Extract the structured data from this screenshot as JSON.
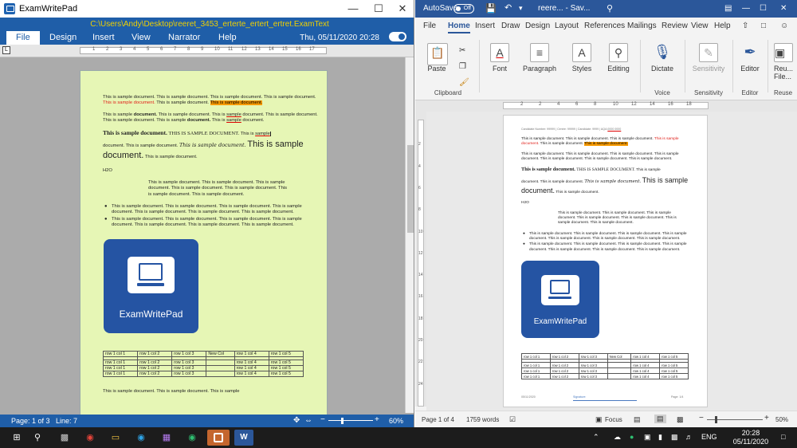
{
  "ewp": {
    "window_title": "ExamWritePad",
    "file_path": "C:\\Users\\Andy\\Desktop\\reeret_3453_erterte_ertert_ertret.ExamText",
    "tabs": [
      "File",
      "Design",
      "Insert",
      "View",
      "Narrator",
      "Help"
    ],
    "datetime": "Thu, 05/11/2020 20:28",
    "ruler_numbers": [
      "1",
      "2",
      "3",
      "4",
      "5",
      "6",
      "7",
      "8",
      "9",
      "10",
      "11",
      "12",
      "13",
      "14",
      "15",
      "16",
      "17"
    ],
    "status": {
      "page": "Page: 1 of 3",
      "line": "Line: 7",
      "zoom": "60%"
    },
    "doc": {
      "p1a": "This is sample document. This is sample document. This is sample document. This is sample",
      "p1b": "document.",
      "p1red": "This is sample document.",
      "p1c": "This is sample document.",
      "p1or": "This is sample document.",
      "p2a": "This is sample",
      "p2b_bold": "document.",
      "p2c": "This is sample document. This is",
      "p2d_u": "sample",
      "p2e": "document. This is sample",
      "p2f": "document. This is sample document. This is sample",
      "p2g_bold": "document.",
      "p2h": "This is",
      "p2i_u": "sample",
      "p2j": "document.",
      "p3_serif_bold": "This is sample document.",
      "p3_caps": "THIS IS SAMPLE DOCUMENT.",
      "p3_tail": "This is",
      "p3_u": "sample",
      "p4a": "document. This is sample document.",
      "p4_ital": "This is sample document.",
      "p4_big": "This is sample",
      "p5_big": "document.",
      "p5_small": "This is sample document.",
      "h2o": "H2O",
      "indent": "This is sample document. This is sample document. This is sample document. This is sample document. This is sample document. This is sample document. This is sample document.",
      "bullets": [
        "This is sample document. This is sample document. This is sample document. This is sample document. This is sample document. This is sample document. This is sample document.",
        "This is sample document. This is sample document. This is sample document. This is sample document. This is sample document. This is sample document. This is sample document."
      ],
      "logo_text": "ExamWritePad",
      "table": [
        [
          "row 1 col 1",
          "row 1 col 2",
          "row 1 col 3",
          "New Col",
          "row 1 col 4",
          "row 1 col 5"
        ],
        [
          "",
          "",
          "",
          "",
          "",
          ""
        ],
        [
          "row 1 col 1",
          "row 1 col 2",
          "row 1 col 3",
          "",
          "row 1 col 4",
          "row 1 col 5"
        ],
        [
          "row 1 col 1",
          "row 1 col 2",
          "row 1 col 3",
          "",
          "row 1 col 4",
          "row 1 col 5"
        ],
        [
          "row 1 col 1",
          "row 1 col 2",
          "row 1 col 3",
          "",
          "row 1 col 4",
          "row 1 col 5"
        ]
      ],
      "last_line": "This is sample document. This is sample document. This is sample"
    }
  },
  "word": {
    "autosave": "AutoSave",
    "autosave_state": "Off",
    "doc_title": "reere... - Sav...",
    "tabs": [
      "File",
      "Home",
      "Insert",
      "Draw",
      "Design",
      "Layout",
      "References",
      "Mailings",
      "Review",
      "View",
      "Help"
    ],
    "ribbon": {
      "paste": "Paste",
      "clipboard": "Clipboard",
      "font": "Font",
      "paragraph": "Paragraph",
      "styles": "Styles",
      "editing": "Editing",
      "dictate": "Dictate",
      "voice": "Voice",
      "sensitivity": "Sensitivity",
      "sensitivity_group": "Sensitivity",
      "editor": "Editor",
      "editor_group": "Editor",
      "reuse_files": "Reu... File...",
      "reuse_group": "Reuse"
    },
    "hruler_numbers": [
      "2",
      "2",
      "4",
      "6",
      "8",
      "10",
      "12",
      "14",
      "16",
      "18"
    ],
    "vruler_numbers": [
      "2",
      "4",
      "6",
      "8",
      "10",
      "12",
      "14",
      "16",
      "18",
      "20",
      "22",
      "24"
    ],
    "doc": {
      "header": "Candidate Number: 99999 | Centre: 99999 | Candidate: 9999 | AQA",
      "header_tail": "0000 0000",
      "p1a": "This is sample document. This is sample document. This is sample document.",
      "p1red": "This is sample document.",
      "p1b": "This is sample document.",
      "p1or": "This is sample document.",
      "p2": "This is sample document. This is sample document. This is sample document. This is sample document. This is sample document. This is sample document. This is sample document.",
      "p3_serif_bold": "This is sample document.",
      "p3_caps": "THIS IS SAMPLE DOCUMENT.",
      "p3_tail": "This is sample",
      "p4a": "document. This is sample document.",
      "p4_ital": "This is sample document.",
      "p4_big": "This is sample",
      "p5_big": "document.",
      "p5_small": "This is sample document.",
      "h2o": "H2O",
      "indent": "This is sample document. This is sample document. This is sample document. This is sample document. This is sample document. This is sample document. This is sample document.",
      "bullets": [
        "This is sample document. This is sample document. This is sample document. This is sample document. This is sample document. This is sample document. This is sample document.",
        "This is sample document. This is sample document. This is sample document. This is sample document. This is sample document. This is sample document. This is sample document."
      ],
      "logo_text": "ExamWritePad",
      "table": [
        [
          "row 1 col 1",
          "row 1 col 2",
          "row 1 col 3",
          "New Col",
          "row 1 col 4",
          "row 1 col 5"
        ],
        [
          "",
          "",
          "",
          "",
          "",
          ""
        ],
        [
          "row 1 col 1",
          "row 1 col 2",
          "row 1 col 3",
          "",
          "row 1 col 4",
          "row 1 col 5"
        ],
        [
          "row 1 col 1",
          "row 1 col 2",
          "row 1 col 3",
          "",
          "row 1 col 4",
          "row 1 col 5"
        ],
        [
          "row 1 col 1",
          "row 1 col 2",
          "row 1 col 3",
          "",
          "row 1 col 4",
          "row 1 col 5"
        ]
      ],
      "footer_left": "05/11/2020",
      "footer_mid": "Signature:",
      "footer_right": "Page: 1/4"
    },
    "status": {
      "page": "Page 1 of 4",
      "words": "1759 words",
      "focus": "Focus",
      "zoom": "50%"
    }
  },
  "taskbar": {
    "lang": "ENG",
    "time": "20:28",
    "date": "05/11/2020"
  },
  "colors": {
    "ewp_blue": "#1f5ea8",
    "word_blue": "#2b579a",
    "page_green": "#e6f6b5",
    "highlight_orange": "#f79a00",
    "red_text": "#e0201a"
  }
}
